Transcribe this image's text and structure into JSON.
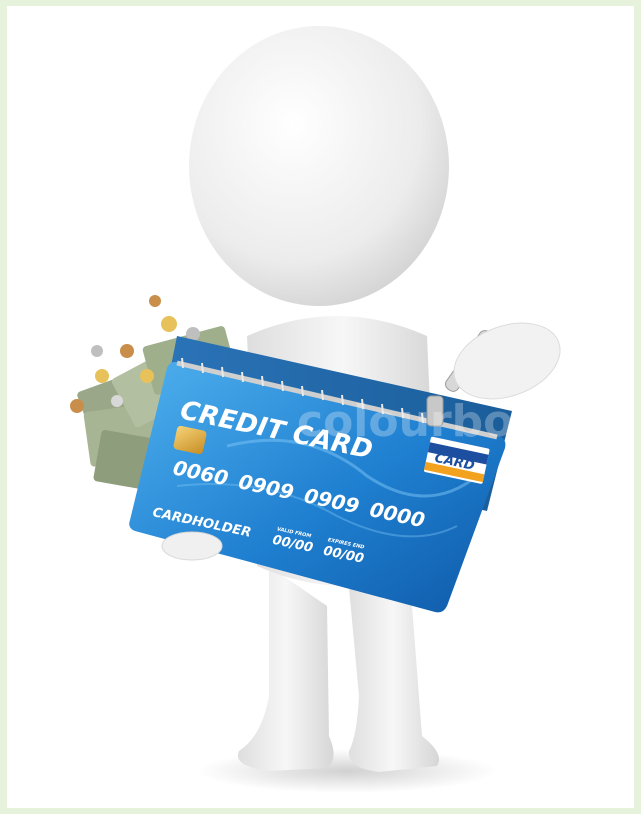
{
  "image": {
    "watermark": "colourbox",
    "card": {
      "title": "CREDIT CARD",
      "number_groups": [
        "0060",
        "0909",
        "0909",
        "0000"
      ],
      "holder": "CARDHOLDER",
      "valid_from_label": "VALID FROM",
      "valid_from": "00/00",
      "expires_label": "EXPIRES END",
      "expires": "00/00",
      "brand": "CARD"
    },
    "colors": {
      "page_border": "#e6f2dc",
      "card_blue": "#1f7fd0",
      "card_light": "#4fb0ee",
      "brand_stripe_blue": "#1d4fa0",
      "brand_stripe_orange": "#f3a21f",
      "figure": "#f2f2f2"
    }
  }
}
